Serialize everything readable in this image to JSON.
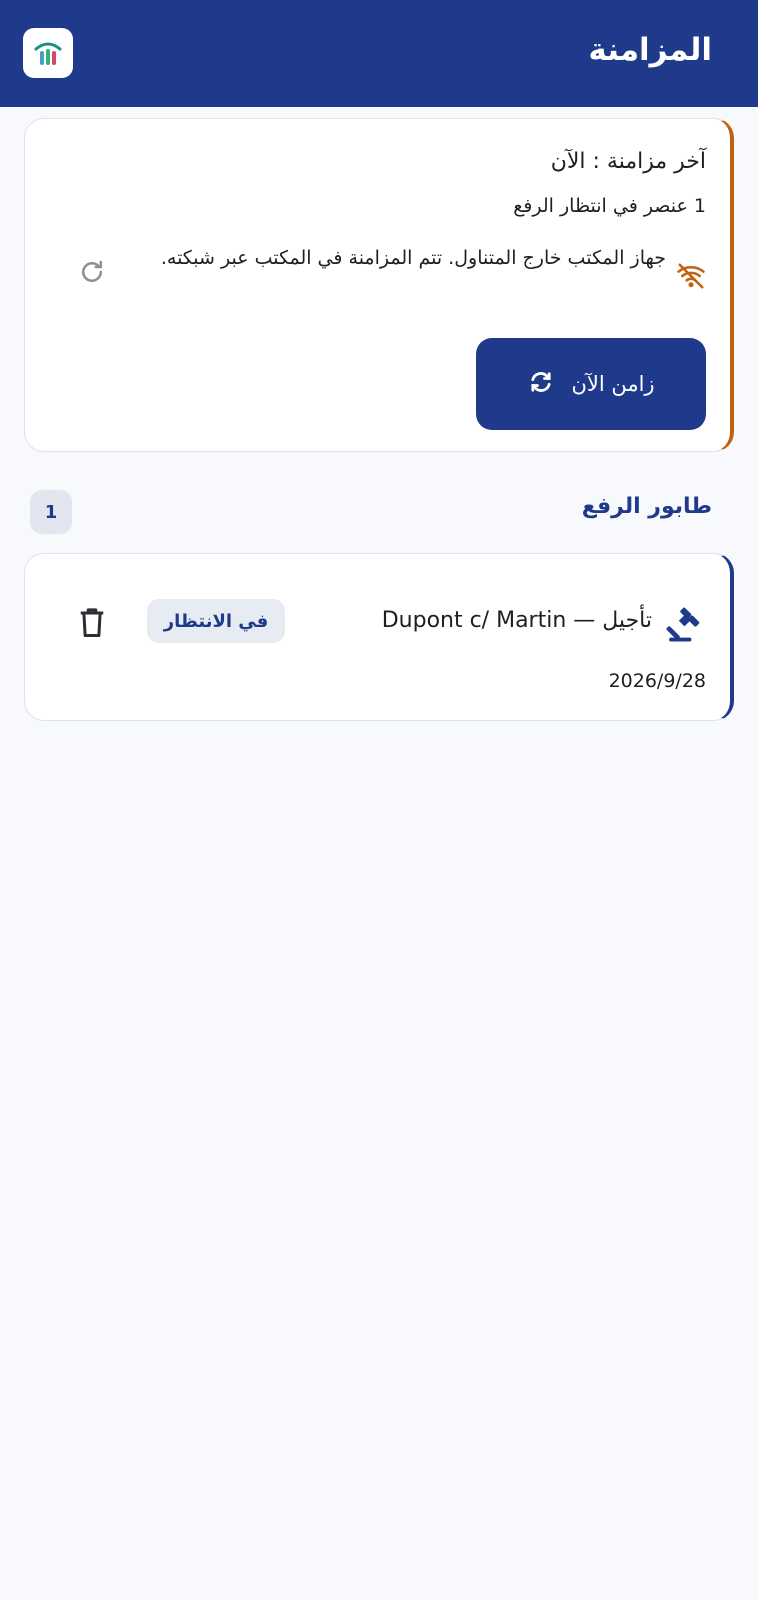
{
  "appbar": {
    "title": "المزامنة",
    "logo_icon": "app-logo-icon"
  },
  "status_card": {
    "last_sync": "آخر مزامنة : الآن",
    "pending": "1 عنصر في انتظار الرفع",
    "offline_icon": "wifi-off-icon",
    "offline_message": "جهاز المكتب خارج المتناول. تتم المزامنة في المكتب عبر شبكته.",
    "refresh_icon": "refresh-icon",
    "sync_button": {
      "label": "زامن الآن",
      "icon": "sync-icon"
    }
  },
  "queue": {
    "title": "طابور الرفع",
    "count": "1",
    "items": [
      {
        "icon": "gavel-icon",
        "title": "تأجيل — Dupont c/ Martin",
        "status": "في الانتظار",
        "date": "2026/9/28",
        "delete_icon": "trash-icon"
      }
    ]
  },
  "colors": {
    "primary": "#1f3a8a",
    "warning": "#c2610f",
    "background": "#f7f9fc"
  }
}
